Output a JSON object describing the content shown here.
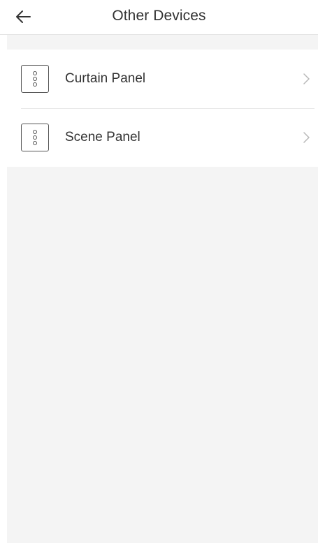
{
  "header": {
    "title": "Other Devices",
    "back_icon": "back-arrow-icon"
  },
  "devices": [
    {
      "label": "Curtain Panel",
      "icon": "panel-device-icon",
      "chevron_icon": "chevron-right-icon"
    },
    {
      "label": "Scene Panel",
      "icon": "panel-device-icon",
      "chevron_icon": "chevron-right-icon"
    }
  ],
  "colors": {
    "background": "#f4f4f4",
    "card": "#ffffff",
    "text": "#333333",
    "divider": "#e8e8e8"
  }
}
